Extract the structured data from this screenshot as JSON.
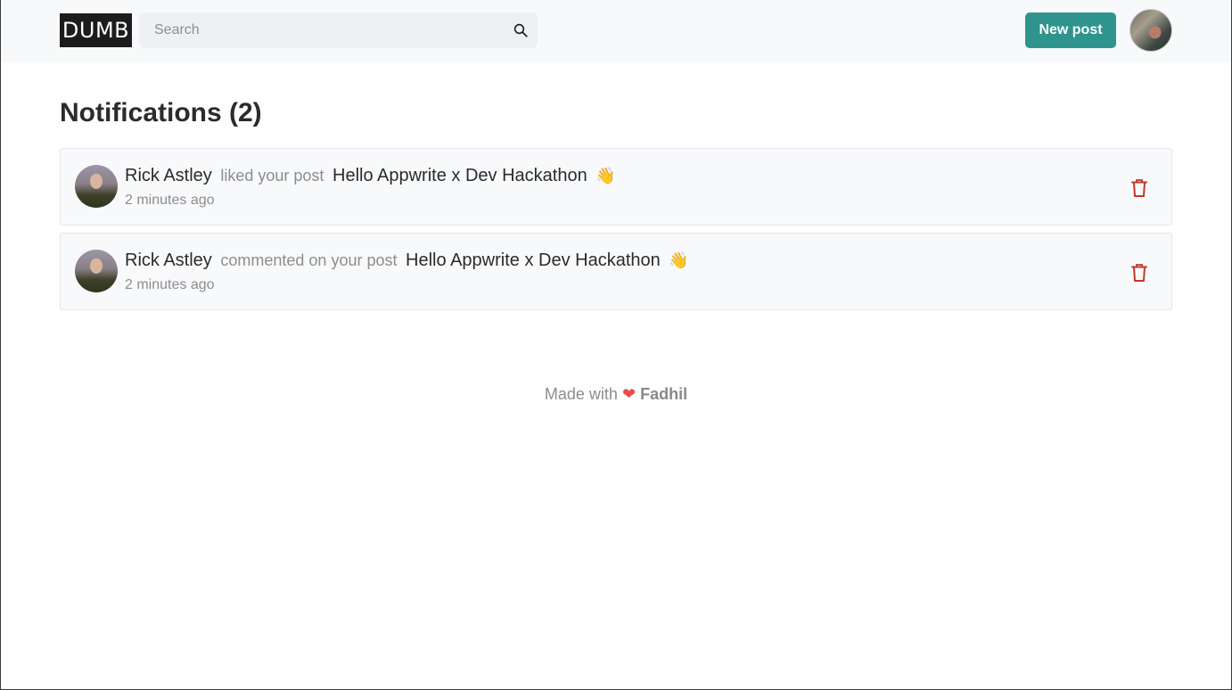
{
  "header": {
    "logo": "DUMB",
    "search": {
      "placeholder": "Search",
      "value": ""
    },
    "new_post_label": "New post",
    "icons": {
      "search": "search-icon",
      "avatar": "user-avatar"
    }
  },
  "main": {
    "title": "Notifications (2)",
    "notifications": [
      {
        "user": "Rick Astley",
        "action": "liked your post",
        "post_title": "Hello Appwrite x Dev Hackathon",
        "emoji": "👋",
        "time": "2 minutes ago"
      },
      {
        "user": "Rick Astley",
        "action": "commented on your post",
        "post_title": "Hello Appwrite x Dev Hackathon",
        "emoji": "👋",
        "time": "2 minutes ago"
      }
    ]
  },
  "footer": {
    "prefix": "Made with",
    "heart": "❤",
    "author": "Fadhil"
  },
  "colors": {
    "accent": "#2f948e",
    "delete": "#c0392b",
    "heart": "#e94b4b",
    "header_bg": "#f8f9fb"
  }
}
